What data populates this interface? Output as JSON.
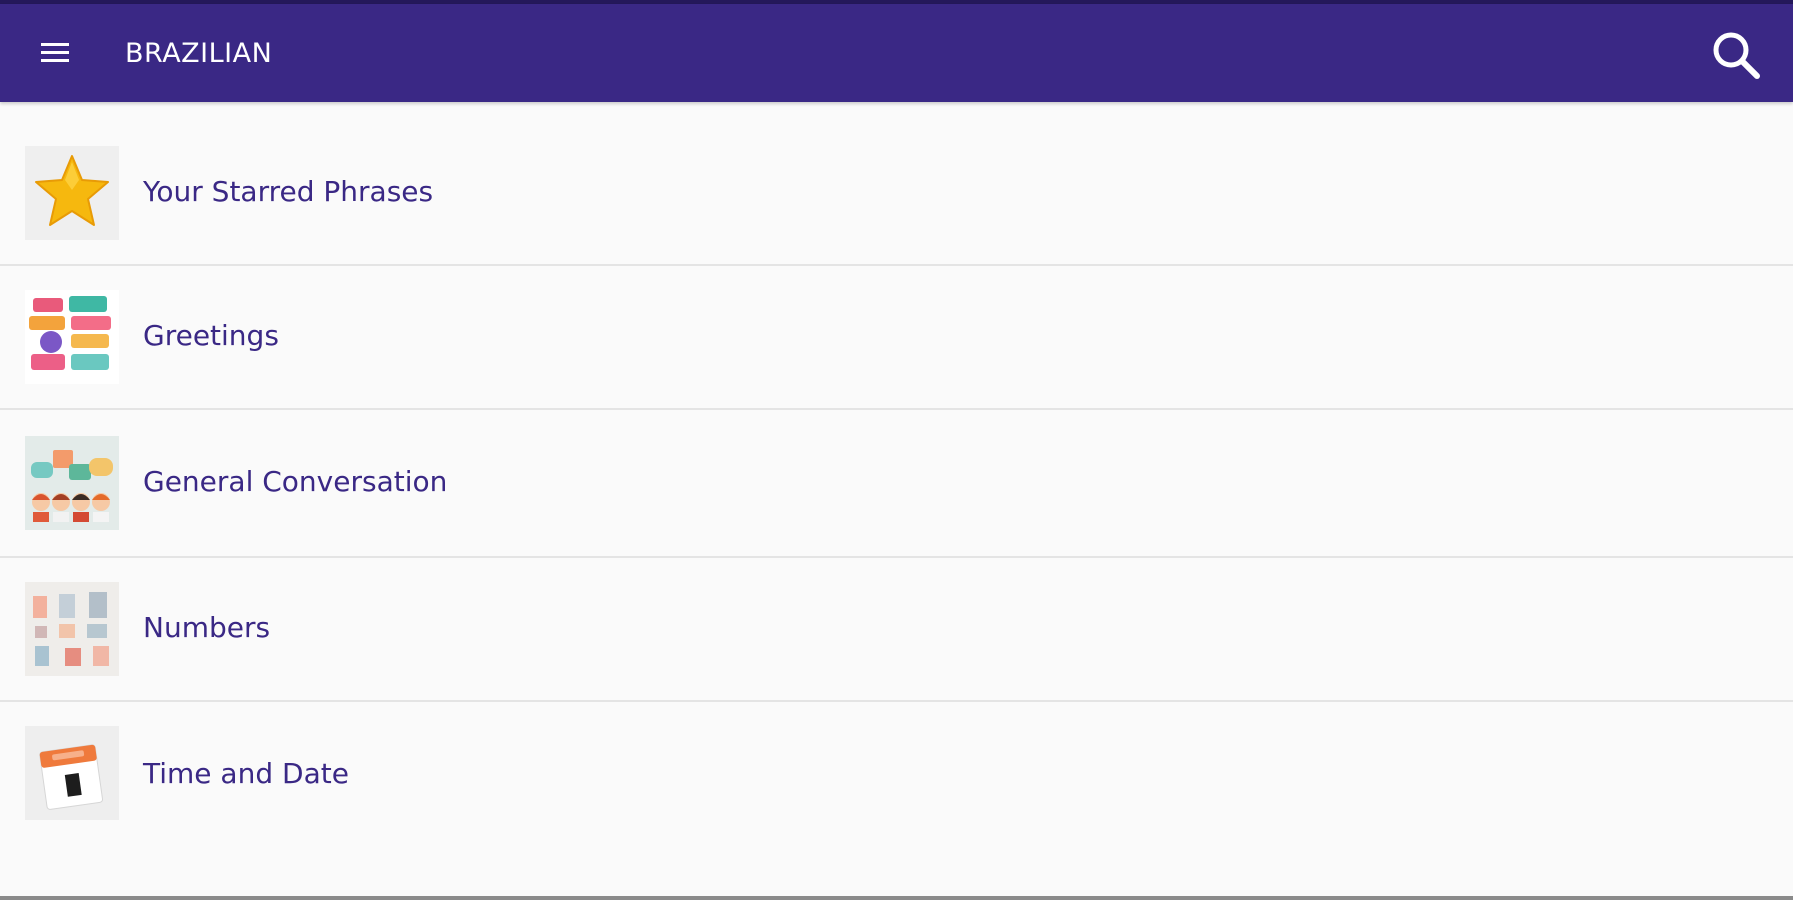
{
  "appbar": {
    "title": "BRAZILIAN",
    "background": "#3a2885",
    "menu_icon": "hamburger-menu-icon",
    "search_icon": "search-icon"
  },
  "categories": [
    {
      "label": "Your Starred Phrases",
      "icon": "star-icon"
    },
    {
      "label": "Greetings",
      "icon": "speech-bubbles-icon"
    },
    {
      "label": "General Conversation",
      "icon": "conversation-people-icon"
    },
    {
      "label": "Numbers",
      "icon": "numbers-icon"
    },
    {
      "label": "Time and Date",
      "icon": "calendar-icon"
    }
  ],
  "colors": {
    "accent": "#3a2885",
    "label_text": "#3a2885",
    "list_background": "#fafafa",
    "divider": "#e4e4e4"
  }
}
